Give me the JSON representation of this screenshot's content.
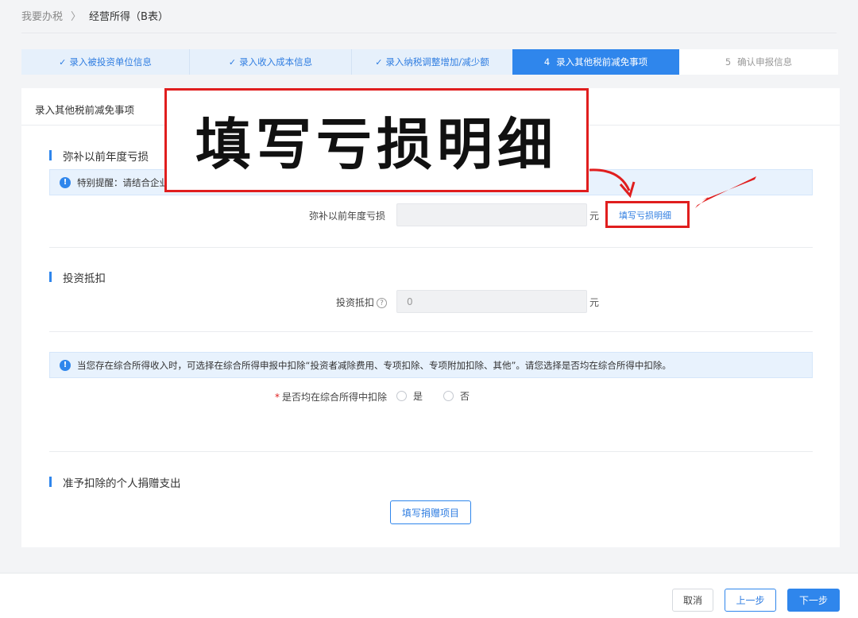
{
  "breadcrumb": {
    "home": "我要办税",
    "separator": "〉",
    "current": "经营所得（B表）"
  },
  "steps": [
    {
      "label": "录入被投资单位信息",
      "status": "done",
      "check": "✓"
    },
    {
      "label": "录入收入成本信息",
      "status": "done",
      "check": "✓"
    },
    {
      "label": "录入纳税调整增加/减少额",
      "status": "done",
      "check": "✓"
    },
    {
      "number": "4",
      "label": "录入其他税前减免事项",
      "status": "active"
    },
    {
      "number": "5",
      "label": "确认申报信息",
      "status": "todo"
    }
  ],
  "card": {
    "title": "录入其他税前减免事项",
    "loss": {
      "section_title": "弥补以前年度亏损",
      "notice_icon": "!",
      "notice_text": "特别提醒：请结合企业",
      "field_label": "弥补以前年度亏损",
      "field_value": "",
      "unit": "元",
      "detail_link": "填写亏损明细"
    },
    "investment": {
      "section_title": "投资抵扣",
      "field_label": "投资抵扣",
      "help_icon": "?",
      "field_value": "0",
      "unit": "元"
    },
    "combined_income": {
      "notice_icon": "!",
      "notice_text": "当您存在综合所得收入时，可选择在综合所得申报中扣除“投资者减除费用、专项扣除、专项附加扣除、其他”。请您选择是否均在综合所得中扣除。",
      "required_mark": "*",
      "question_label": "是否均在综合所得中扣除",
      "option_yes": "是",
      "option_no": "否"
    },
    "donation": {
      "section_title": "准予扣除的个人捐赠支出",
      "button_label": "填写捐赠项目"
    }
  },
  "footer": {
    "cancel_label": "取消",
    "prev_label": "上一步",
    "next_label": "下一步"
  },
  "annotation": {
    "callout_text": "填写亏损明细",
    "color": "#e01e1e"
  },
  "colors": {
    "primary": "#2f86ec",
    "step_done_bg": "#e6f0fb",
    "notice_bg": "#e8f2fd"
  }
}
